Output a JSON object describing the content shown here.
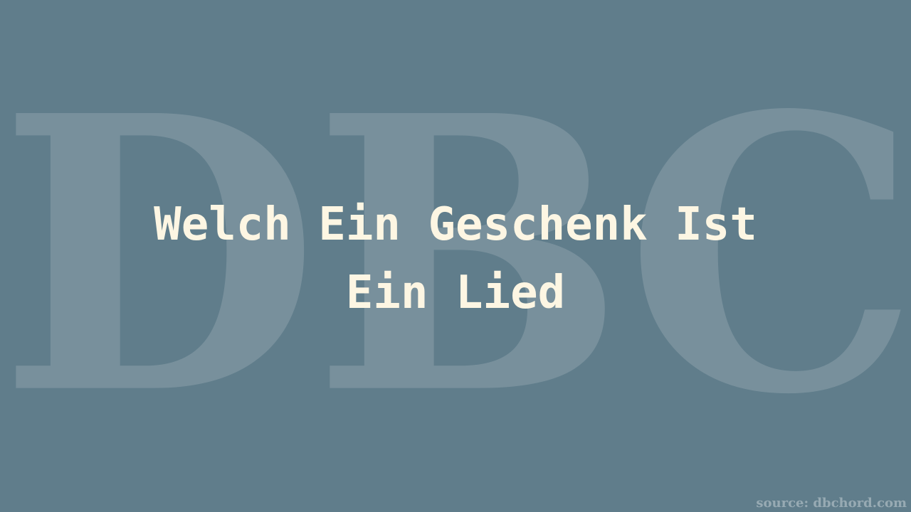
{
  "background_color": "#607d8b",
  "text_color": "#fdf6e3",
  "watermark": {
    "text": "DBC"
  },
  "title": {
    "line1": "Welch Ein Geschenk Ist",
    "line2": "Ein Lied"
  },
  "source": {
    "text": "source: dbchord.com"
  }
}
